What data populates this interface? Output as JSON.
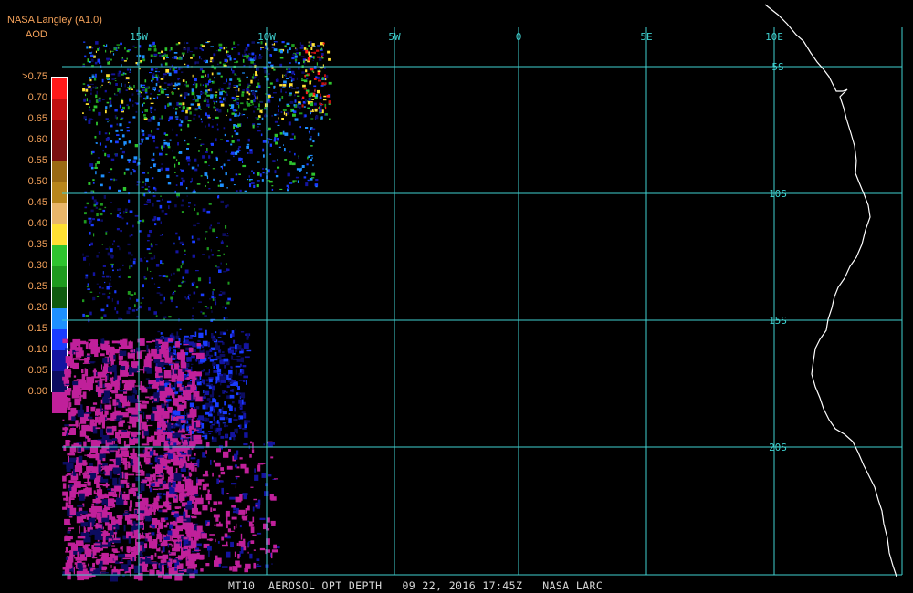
{
  "header": {
    "title": "NASA Langley (A1.0)",
    "unit": "AOD"
  },
  "legend": {
    "labels": [
      ">0.75",
      "0.70",
      "0.65",
      "0.60",
      "0.55",
      "0.50",
      "0.45",
      "0.40",
      "0.35",
      "0.30",
      "0.25",
      "0.20",
      "0.15",
      "0.10",
      "0.05",
      "0.00"
    ],
    "colors": [
      "#ff1a1a",
      "#c01010",
      "#8f0b0b",
      "#7a1010",
      "#9a6a14",
      "#b8861c",
      "#e9b66a",
      "#ffe033",
      "#2ec42e",
      "#1e9a1e",
      "#0f5a0f",
      "#1e90ff",
      "#1a3cff",
      "#1414a0",
      "#0c0c60",
      "#c0209a"
    ]
  },
  "grid": {
    "lon_labels": [
      "15W",
      "10W",
      "5W",
      "0",
      "5E",
      "10E"
    ],
    "lat_labels": [
      "5S",
      "10S",
      "15S",
      "20S"
    ]
  },
  "footer": {
    "product": "MT10",
    "variable": "AEROSOL OPT DEPTH",
    "datetime": "09 22, 2016 17:45Z",
    "source": "NASA LARC"
  },
  "colors": {
    "grid": "#3fd0cf",
    "coastline": "#ffffff",
    "low_aod": "#c0209a",
    "label": "#f5a25a"
  }
}
